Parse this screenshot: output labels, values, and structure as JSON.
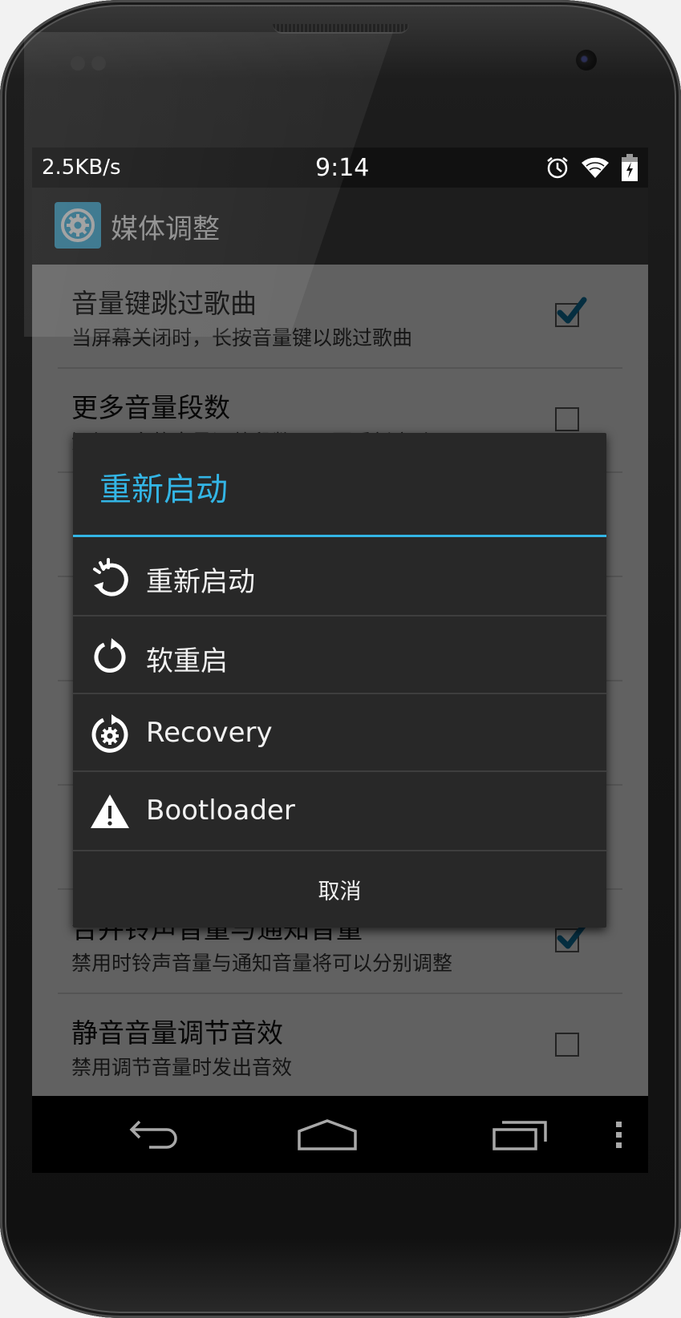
{
  "status_bar": {
    "network_speed": "2.5KB/s",
    "time": "9:14",
    "icons": [
      "alarm-icon",
      "wifi-icon",
      "battery-charging-icon"
    ]
  },
  "action_bar": {
    "app_icon": "gear-icon",
    "title": "媒体调整"
  },
  "settings": [
    {
      "title": "音量键跳过歌曲",
      "subtitle": "当屏幕关闭时，长按音量键以跳过歌曲",
      "checked": true
    },
    {
      "title": "更多音量段数",
      "subtitle": "添加更多的音量调整段数，需要重新启动",
      "checked": false
    },
    {
      "title": "",
      "subtitle": "",
      "checked": false
    },
    {
      "title": "",
      "subtitle": "",
      "checked": false
    },
    {
      "title": "",
      "subtitle": "",
      "checked": false
    },
    {
      "title": "合并铃声音量与通知音量",
      "subtitle": "禁用时铃声音量与通知音量将可以分别调整",
      "checked": true
    },
    {
      "title": "静音音量调节音效",
      "subtitle": "禁用调节音量时发出音效",
      "checked": false
    }
  ],
  "dialog": {
    "title": "重新启动",
    "accent_color": "#33b5e5",
    "options": [
      {
        "label": "重新启动",
        "icon": "reboot-icon"
      },
      {
        "label": "软重启",
        "icon": "soft-reboot-icon"
      },
      {
        "label": "Recovery",
        "icon": "recovery-gear-icon"
      },
      {
        "label": "Bootloader",
        "icon": "warning-icon"
      }
    ],
    "cancel_label": "取消"
  },
  "nav_bar": {
    "buttons": [
      "back-icon",
      "home-icon",
      "recent-apps-icon",
      "overflow-menu-icon"
    ]
  }
}
